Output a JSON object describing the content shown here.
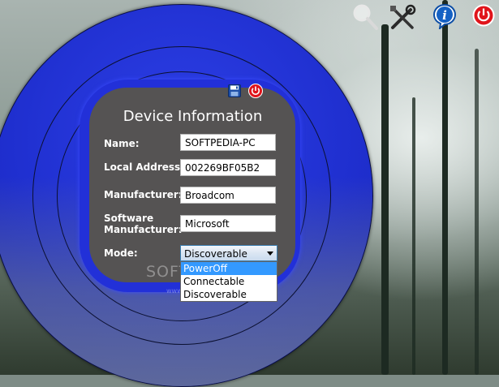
{
  "panel": {
    "title": "Device Information",
    "fields": [
      {
        "label": "Name:",
        "value": "SOFTPEDIA-PC"
      },
      {
        "label": "Local Address:",
        "value": "002269BF05B2"
      },
      {
        "label": "Manufacturer:",
        "value": "Broadcom"
      },
      {
        "label": "Software Manufacturer:",
        "value": "Microsoft"
      }
    ],
    "mode": {
      "label": "Mode:",
      "selected": "Discoverable",
      "options": [
        "PowerOff",
        "Connectable",
        "Discoverable"
      ],
      "highlighted": "PowerOff"
    }
  },
  "toolbar_icons": [
    "search-icon",
    "tools-icon",
    "info-icon",
    "power-icon"
  ],
  "panel_icons": [
    "save-icon",
    "power-icon"
  ],
  "watermark": {
    "main": "SOFTPEDIA",
    "sub": "www.softpedia.com"
  },
  "colors": {
    "circle_blue": "#1f2fcf",
    "panel_gray": "#555353",
    "selection": "#3399ff",
    "power_red": "#e0141b"
  }
}
